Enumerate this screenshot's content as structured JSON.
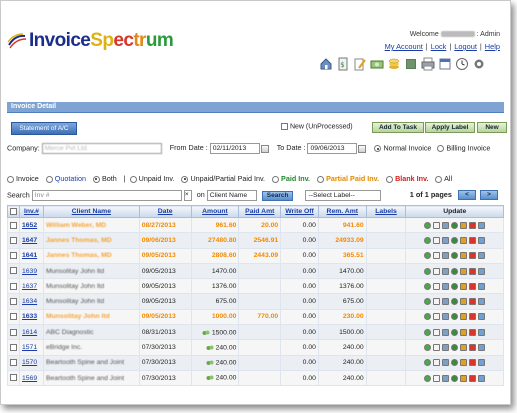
{
  "header": {
    "logo_text": "InvoiceSpectrum",
    "welcome_prefix": "Welcome",
    "welcome_suffix": ": Admin",
    "links": [
      "My Account",
      "Lock",
      "Logout",
      "Help"
    ],
    "tool_icons": [
      "home-icon",
      "invoice-icon",
      "edit-document-icon",
      "money-icon",
      "coins-icon",
      "book-icon",
      "print-icon",
      "calendar-icon",
      "clock-icon",
      "settings-icon"
    ]
  },
  "panel": {
    "title": "Invoice Detail",
    "statement_button": "Statement of A/C",
    "unprocessed_label": "New (UnProcessed)",
    "add_to_task": "Add To Task",
    "apply_label": "Apply Label",
    "new_button": "New"
  },
  "filters": {
    "company_label": "Company:",
    "company_value": "Merce Pvt Ltd.",
    "from_date_label": "From Date :",
    "from_date": "02/11/2013",
    "to_date_label": "To Date :",
    "to_date": "09/06/2013",
    "normal_invoice": "Normal Invoice",
    "billing_invoice": "Billing Invoice",
    "type_options": [
      "Invoice",
      "Quotation",
      "Both"
    ],
    "status_options": [
      "Unpaid Inv.",
      "Unpaid/Partial Paid Inv.",
      "Paid Inv.",
      "Partial Paid Inv.",
      "Blank Inv.",
      "All"
    ],
    "status_colors": {
      "paid": "#1f8a2a",
      "partial": "#e08a00",
      "blank": "#d0201a",
      "quotation": "#1a3ea8"
    }
  },
  "search": {
    "label": "Search",
    "placeholder": "Inv #",
    "on_label": "on",
    "field_select": "Client Name",
    "button": "Search",
    "label_select": "--Select Label--",
    "pager_text": "1 of 1 pages",
    "prev": "<",
    "next": ">"
  },
  "table": {
    "columns": [
      "Inv.#",
      "Client Name",
      "Date",
      "Amount",
      "Paid Amt",
      "Write Off",
      "Rem. Amt",
      "Labels",
      "Update"
    ],
    "rows": [
      {
        "inv": "1652",
        "client": "William Weber, MD",
        "date": "08/27/2013",
        "amount": "961.60",
        "paid": "20.00",
        "writeoff": "0.00",
        "rem": "941.60",
        "highlight": true,
        "attach": false
      },
      {
        "inv": "1647",
        "client": "Jannes Thomas, MD",
        "date": "09/06/2013",
        "amount": "27480.80",
        "paid": "2546.91",
        "writeoff": "0.00",
        "rem": "24933.09",
        "highlight": true,
        "attach": false
      },
      {
        "inv": "1641",
        "client": "Jannes Thomas, MD",
        "date": "09/05/2013",
        "amount": "2808.60",
        "paid": "2443.09",
        "writeoff": "0.00",
        "rem": "365.51",
        "highlight": true,
        "attach": false
      },
      {
        "inv": "1639",
        "client": "Munsolitay John ltd",
        "date": "09/05/2013",
        "amount": "1470.00",
        "paid": "",
        "writeoff": "0.00",
        "rem": "1470.00",
        "highlight": false,
        "attach": false
      },
      {
        "inv": "1637",
        "client": "Munsolitay John ltd",
        "date": "09/05/2013",
        "amount": "1376.00",
        "paid": "",
        "writeoff": "0.00",
        "rem": "1376.00",
        "highlight": false,
        "attach": false
      },
      {
        "inv": "1634",
        "client": "Munsolitay John ltd",
        "date": "09/05/2013",
        "amount": "675.00",
        "paid": "",
        "writeoff": "0.00",
        "rem": "675.00",
        "highlight": false,
        "attach": false
      },
      {
        "inv": "1633",
        "client": "Munsolitay John ltd",
        "date": "09/05/2013",
        "amount": "1000.00",
        "paid": "770.00",
        "writeoff": "0.00",
        "rem": "230.00",
        "highlight": true,
        "attach": false
      },
      {
        "inv": "1614",
        "client": "ABC Diagnostic",
        "date": "08/31/2013",
        "amount": "1500.00",
        "paid": "",
        "writeoff": "0.00",
        "rem": "1500.00",
        "highlight": false,
        "attach": true
      },
      {
        "inv": "1571",
        "client": "eBridge Inc.",
        "date": "07/30/2013",
        "amount": "240.00",
        "paid": "",
        "writeoff": "0.00",
        "rem": "240.00",
        "highlight": false,
        "attach": true
      },
      {
        "inv": "1570",
        "client": "Beartooth Spine and Joint",
        "date": "07/30/2013",
        "amount": "240.00",
        "paid": "",
        "writeoff": "0.00",
        "rem": "240.00",
        "highlight": false,
        "attach": true
      },
      {
        "inv": "1569",
        "client": "Beartooth Spine and Joint",
        "date": "07/30/2013",
        "amount": "240.00",
        "paid": "",
        "writeoff": "0.00",
        "rem": "240.00",
        "highlight": false,
        "attach": true
      }
    ],
    "update_icons": [
      "refresh-icon",
      "edit-icon",
      "mail-icon",
      "status-icon",
      "pdf-icon",
      "delete-icon",
      "attach-icon"
    ]
  }
}
